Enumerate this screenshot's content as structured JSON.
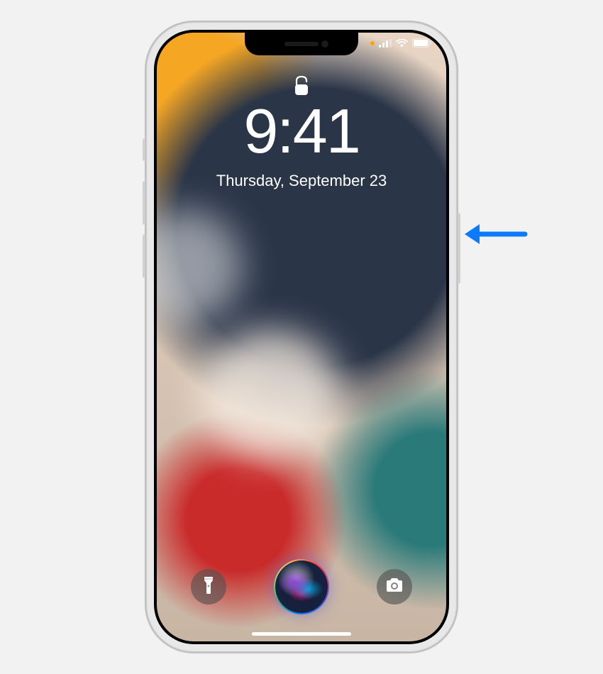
{
  "lockscreen": {
    "time": "9:41",
    "date": "Thursday, September 23",
    "locked": false
  },
  "status": {
    "location_active": true,
    "cellular_bars": 3,
    "wifi_active": true,
    "battery_level": 100
  },
  "controls": {
    "flashlight": "flashlight",
    "siri": "siri",
    "camera": "camera"
  },
  "annotation": {
    "arrow_color": "#0a7aff",
    "target": "side-button"
  }
}
